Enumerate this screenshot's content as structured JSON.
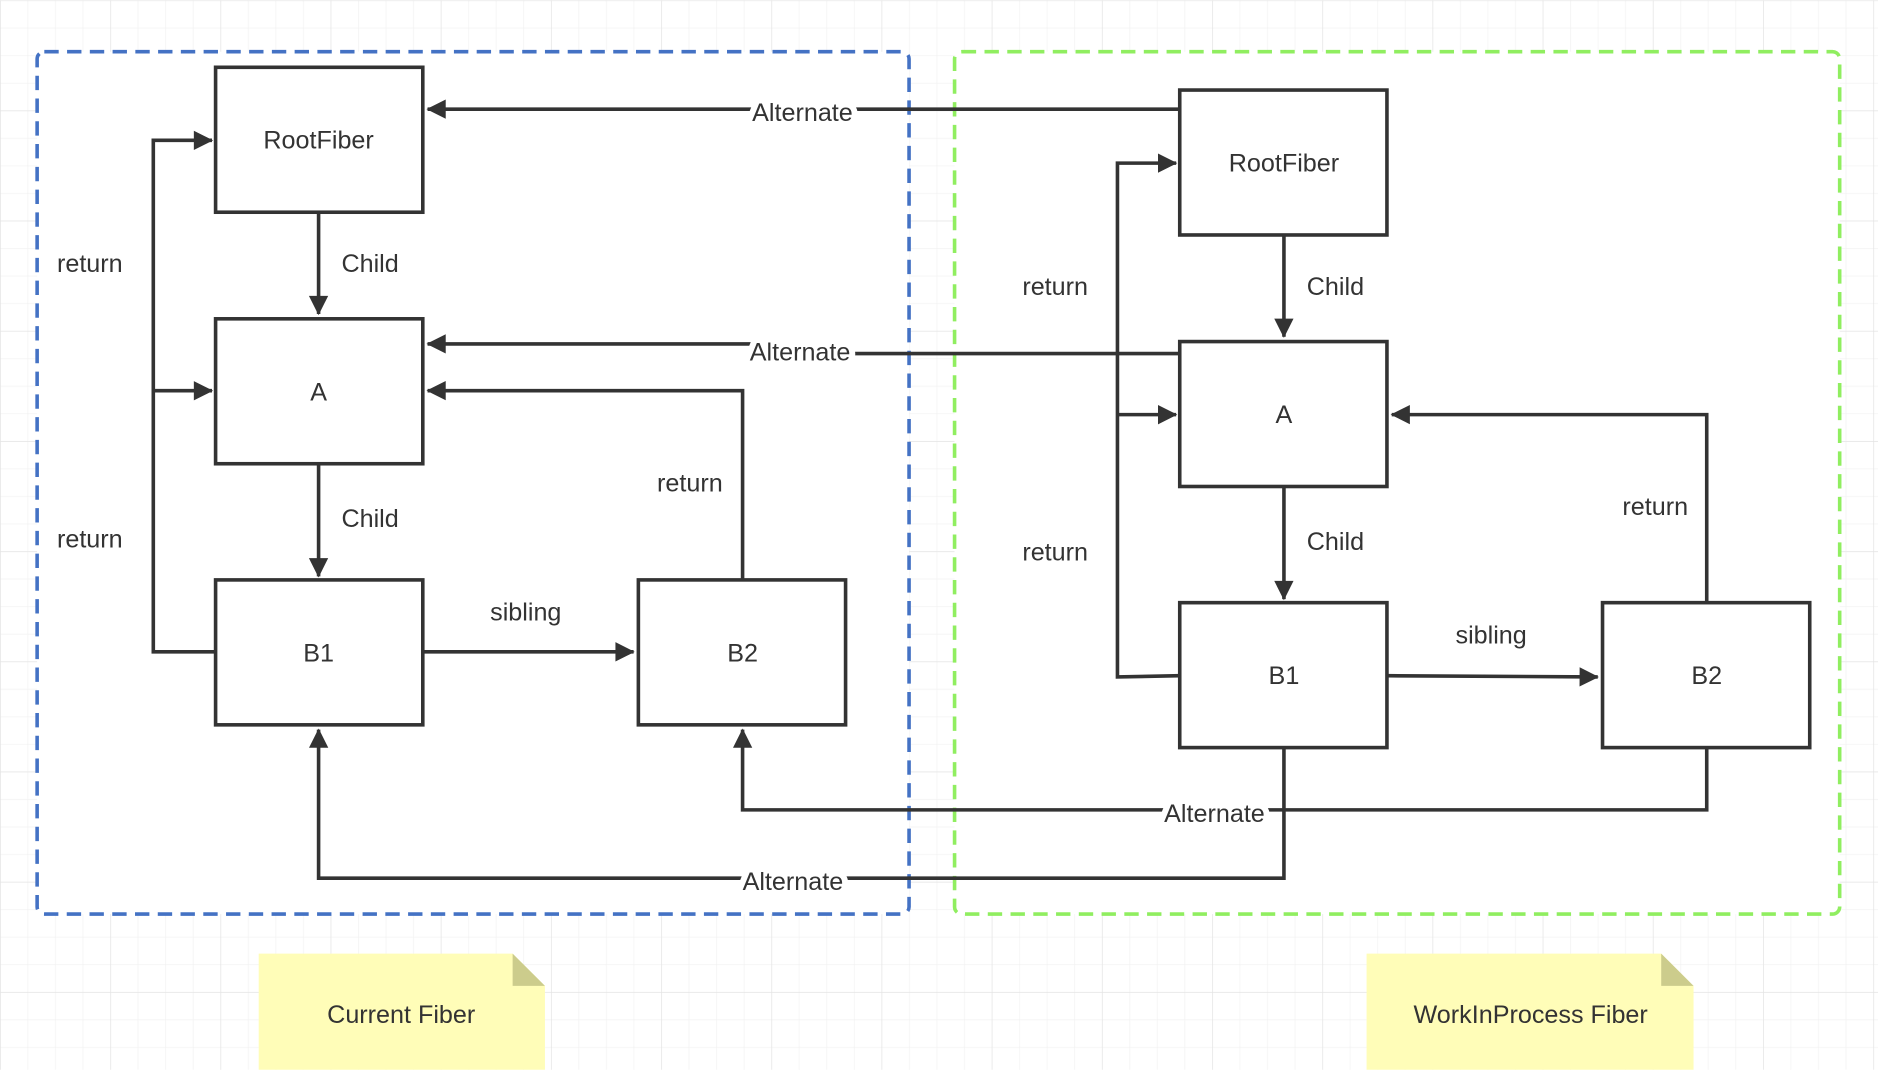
{
  "colors": {
    "current_group_border": "#4472C4",
    "workinprocess_group_border": "#90EE60",
    "node_border": "#333333",
    "note_fill": "#FFFDB8",
    "note_fold": "#CCCC8C",
    "grid": "#EEEEEE"
  },
  "current": {
    "nodes": {
      "root": "RootFiber",
      "a": "A",
      "b1": "B1",
      "b2": "B2"
    },
    "edges": {
      "child_root_a": "Child",
      "child_a_b1": "Child",
      "return_upper": "return",
      "return_lower": "return",
      "return_b2_a": "return",
      "sibling": "sibling"
    },
    "note": "Current Fiber"
  },
  "workinprocess": {
    "nodes": {
      "root": "RootFiber",
      "a": "A",
      "b1": "B1",
      "b2": "B2"
    },
    "edges": {
      "child_root_a": "Child",
      "child_a_b1": "Child",
      "return_upper": "return",
      "return_lower": "return",
      "return_b2_a": "return",
      "sibling": "sibling"
    },
    "note": "WorkInProcess Fiber"
  },
  "alternate": {
    "root": "Alternate",
    "a": "Alternate",
    "b2": "Alternate",
    "b1": "Alternate"
  }
}
